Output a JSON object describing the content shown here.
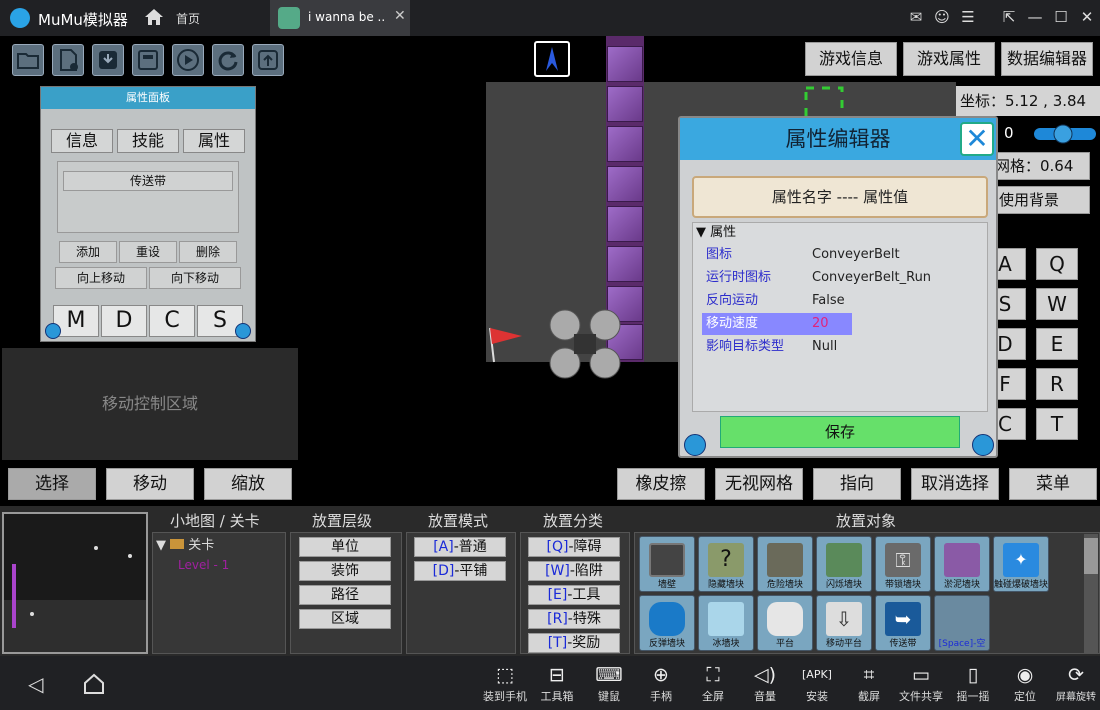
{
  "titlebar": {
    "app_name": "MuMu模拟器",
    "home_tab": "首页",
    "game_tab": "i wanna be ..",
    "close": "✕"
  },
  "window_controls": [
    "mail-icon",
    "user-icon",
    "menu-icon",
    "screenshot-icon",
    "minimize-icon",
    "maximize-icon",
    "close-icon"
  ],
  "panel": {
    "title": "属性面板",
    "tabs": [
      "信息",
      "技能",
      "属性"
    ],
    "selected_item": "传送带",
    "buttons": [
      "添加",
      "重设",
      "删除"
    ],
    "move_buttons": [
      "向上移动",
      "向下移动"
    ],
    "mdcs": [
      "M",
      "D",
      "C",
      "S"
    ]
  },
  "move_area": "移动控制区域",
  "top_buttons": [
    "游戏信息",
    "游戏属性",
    "数据编辑器"
  ],
  "coord": "坐标：5.12 , 3.84",
  "right_info": {
    "zoom": "0",
    "grid": "网格：0.64",
    "background": "使用背景"
  },
  "keys": [
    "A",
    "Q",
    "S",
    "W",
    "D",
    "E",
    "F",
    "R",
    "C",
    "T"
  ],
  "dialog": {
    "title": "属性编辑器",
    "header": "属性名字 ---- 属性值",
    "group": "▼ 属性",
    "rows": [
      {
        "name": "图标",
        "value": "ConveyerBelt"
      },
      {
        "name": "运行时图标",
        "value": "ConveyerBelt_Run"
      },
      {
        "name": "反向运动",
        "value": "False"
      },
      {
        "name": "移动速度",
        "value": "20"
      },
      {
        "name": "影响目标类型",
        "value": "Null"
      }
    ],
    "save": "保存"
  },
  "actions_left": [
    "选择",
    "移动",
    "缩放"
  ],
  "actions_right": [
    "橡皮擦",
    "无视网格",
    "指向",
    "取消选择",
    "菜单"
  ],
  "columns": {
    "minimap": {
      "title": "小地图 / 关卡",
      "folder": "关卡",
      "level": "Level - 1"
    },
    "layer": {
      "title": "放置层级",
      "items": [
        "单位",
        "装饰",
        "路径",
        "区域"
      ]
    },
    "mode": {
      "title": "放置模式",
      "items": [
        {
          "key": "[A]",
          "label": "-普通"
        },
        {
          "key": "[D]",
          "label": "-平铺"
        }
      ]
    },
    "category": {
      "title": "放置分类",
      "items": [
        {
          "key": "[Q]",
          "label": "-障碍"
        },
        {
          "key": "[W]",
          "label": "-陷阱"
        },
        {
          "key": "[E]",
          "label": "-工具"
        },
        {
          "key": "[R]",
          "label": "-特殊"
        },
        {
          "key": "[T]",
          "label": "-奖励"
        }
      ]
    },
    "objects": {
      "title": "放置对象",
      "items": [
        "墙壁",
        "隐藏墙块",
        "危险墙块",
        "闪烁墙块",
        "带锁墙块",
        "淤泥墙块",
        "触碰爆破墙块",
        "反弹墙块",
        "冰墙块",
        "平台",
        "移动平台",
        "传送带",
        "[Space]-空"
      ]
    }
  },
  "navbar": [
    "装到手机",
    "工具箱",
    "键鼠",
    "手柄",
    "全屏",
    "音量",
    "安装",
    "截屏",
    "文件共享",
    "摇一摇",
    "定位",
    "屏幕旋转"
  ],
  "colors": {
    "accent": "#3aa8e0",
    "save": "#66e06a",
    "highlight": "#8888ff"
  }
}
